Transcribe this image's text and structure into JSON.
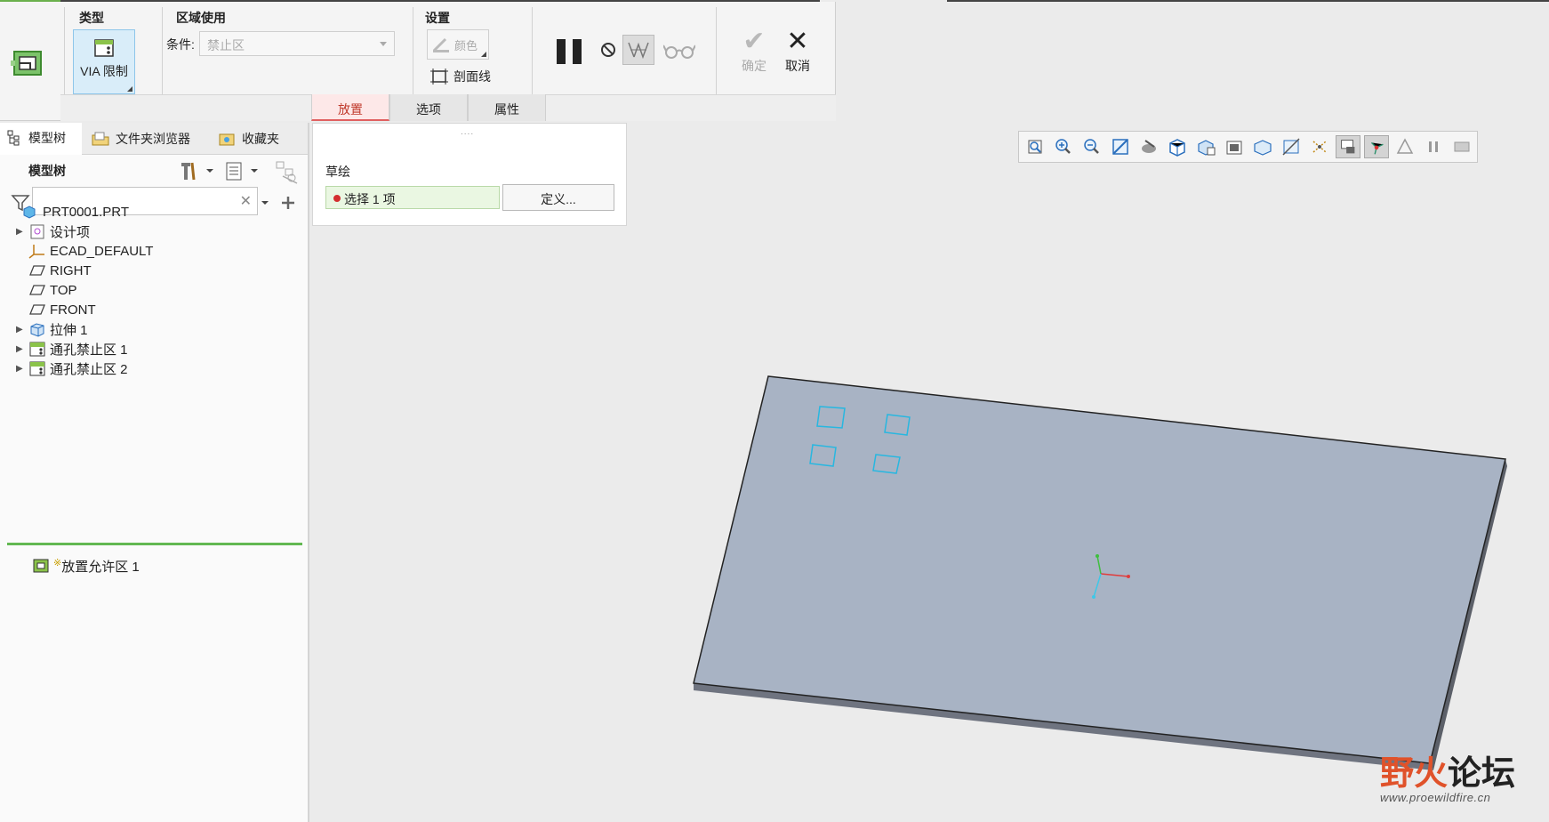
{
  "ribbon": {
    "type_group": {
      "title": "类型",
      "button_label": "VIA 限制"
    },
    "area_group": {
      "title": "区域使用",
      "condition_label": "条件:",
      "condition_value": "禁止区"
    },
    "settings_group": {
      "title": "设置",
      "color_label": "颜色",
      "hatch_label": "剖面线"
    },
    "ok_label": "确定",
    "cancel_label": "取消",
    "tabs": [
      {
        "label": "放置",
        "active": true
      },
      {
        "label": "选项",
        "active": false
      },
      {
        "label": "属性",
        "active": false
      }
    ]
  },
  "placement_panel": {
    "grip": "....",
    "sketch_label": "草绘",
    "collector_text": "选择 1 项",
    "define_label": "定义..."
  },
  "navigator": {
    "tabs": [
      {
        "label": "模型树",
        "icon": "model-tree-icon",
        "active": true
      },
      {
        "label": "文件夹浏览器",
        "icon": "folder-browser-icon",
        "active": false
      },
      {
        "label": "收藏夹",
        "icon": "favorites-icon",
        "active": false
      }
    ],
    "tree_title": "模型树",
    "filter_placeholder": "",
    "tree_items": [
      {
        "label": "PRT0001.PRT",
        "icon": "part-icon",
        "expandable": false,
        "indent": 0
      },
      {
        "label": "设计项",
        "icon": "design-items-icon",
        "expandable": true,
        "indent": 1
      },
      {
        "label": "ECAD_DEFAULT",
        "icon": "csys-icon",
        "expandable": false,
        "indent": 1
      },
      {
        "label": "RIGHT",
        "icon": "datum-plane-icon",
        "expandable": false,
        "indent": 1
      },
      {
        "label": "TOP",
        "icon": "datum-plane-icon",
        "expandable": false,
        "indent": 1
      },
      {
        "label": "FRONT",
        "icon": "datum-plane-icon",
        "expandable": false,
        "indent": 1
      },
      {
        "label": "拉伸 1",
        "icon": "extrude-icon",
        "expandable": true,
        "indent": 1
      },
      {
        "label": "通孔禁止区 1",
        "icon": "via-keepout-icon",
        "expandable": true,
        "indent": 1
      },
      {
        "label": "通孔禁止区 2",
        "icon": "via-keepout-icon",
        "expandable": true,
        "indent": 1
      }
    ],
    "new_feature": {
      "label": "放置允许区 1",
      "marker": "※",
      "icon": "place-keepin-icon"
    }
  },
  "view_toolbar": {
    "buttons": [
      "refit-icon",
      "zoom-in-icon",
      "zoom-out-icon",
      "repaint-icon",
      "render-icon",
      "display-style-icon",
      "saved-orientations-icon",
      "view-manager-icon",
      "perspective-icon",
      "section-icon",
      "datum-display-icon",
      "annotation-display-icon",
      "spin-center-icon",
      "appearance-icon",
      "pause-animation-icon",
      "hidden-icon"
    ],
    "active": [
      "annotation-display-icon",
      "spin-center-icon"
    ]
  },
  "watermark": {
    "prefix": "野",
    "fire": "火",
    "suffix": "论坛",
    "url": "www.proewildfire.cn"
  },
  "colors": {
    "accent_red": "#c0392b",
    "collector_bg": "#eaf7e2",
    "model_face": "#a8b3c4",
    "sketch_cyan": "#28b7e0",
    "insert_green": "#62b852"
  }
}
